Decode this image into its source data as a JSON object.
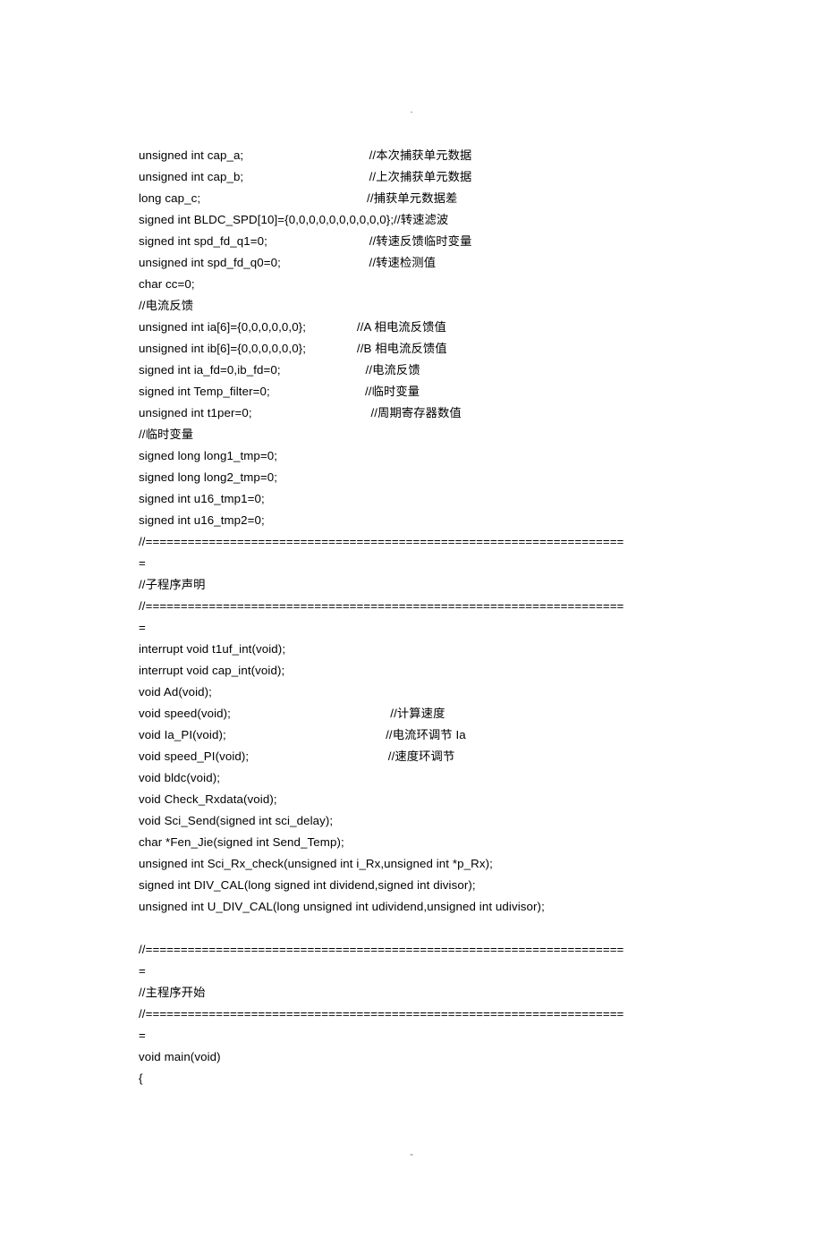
{
  "top_marker": ".",
  "bottom_marker": "-",
  "lines": [
    "unsigned int cap_a;                                     //本次捕获单元数据",
    "unsigned int cap_b;                                     //上次捕获单元数据",
    "long cap_c;                                                 //捕获单元数据差",
    "signed int BLDC_SPD[10]={0,0,0,0,0,0,0,0,0,0};//转速滤波",
    "signed int spd_fd_q1=0;                              //转速反馈临时变量",
    "unsigned int spd_fd_q0=0;                          //转速检测值",
    "char cc=0;",
    "//电流反馈",
    "unsigned int ia[6]={0,0,0,0,0,0};               //A 相电流反馈值",
    "unsigned int ib[6]={0,0,0,0,0,0};               //B 相电流反馈值",
    "signed int ia_fd=0,ib_fd=0;                         //电流反馈",
    "signed int Temp_filter=0;                            //临时变量",
    "unsigned int t1per=0;                                   //周期寄存器数值",
    "//临时变量",
    "signed long long1_tmp=0;",
    "signed long long2_tmp=0;",
    "signed int u16_tmp1=0;",
    "signed int u16_tmp2=0;",
    "//====================================================================",
    "=",
    "//子程序声明",
    "//====================================================================",
    "=",
    "interrupt void t1uf_int(void);",
    "interrupt void cap_int(void);",
    "void Ad(void);",
    "void speed(void);                                               //计算速度",
    "void Ia_PI(void);                                               //电流环调节 Ia",
    "void speed_PI(void);                                         //速度环调节",
    "void bldc(void);",
    "void Check_Rxdata(void);",
    "void Sci_Send(signed int sci_delay);",
    "char *Fen_Jie(signed int Send_Temp);",
    "unsigned int Sci_Rx_check(unsigned int i_Rx,unsigned int *p_Rx);",
    "signed int DIV_CAL(long signed int dividend,signed int divisor);",
    "unsigned int U_DIV_CAL(long unsigned int udividend,unsigned int udivisor);",
    "",
    "//====================================================================",
    "=",
    "//主程序开始",
    "//====================================================================",
    "=",
    "void main(void)",
    "{"
  ]
}
